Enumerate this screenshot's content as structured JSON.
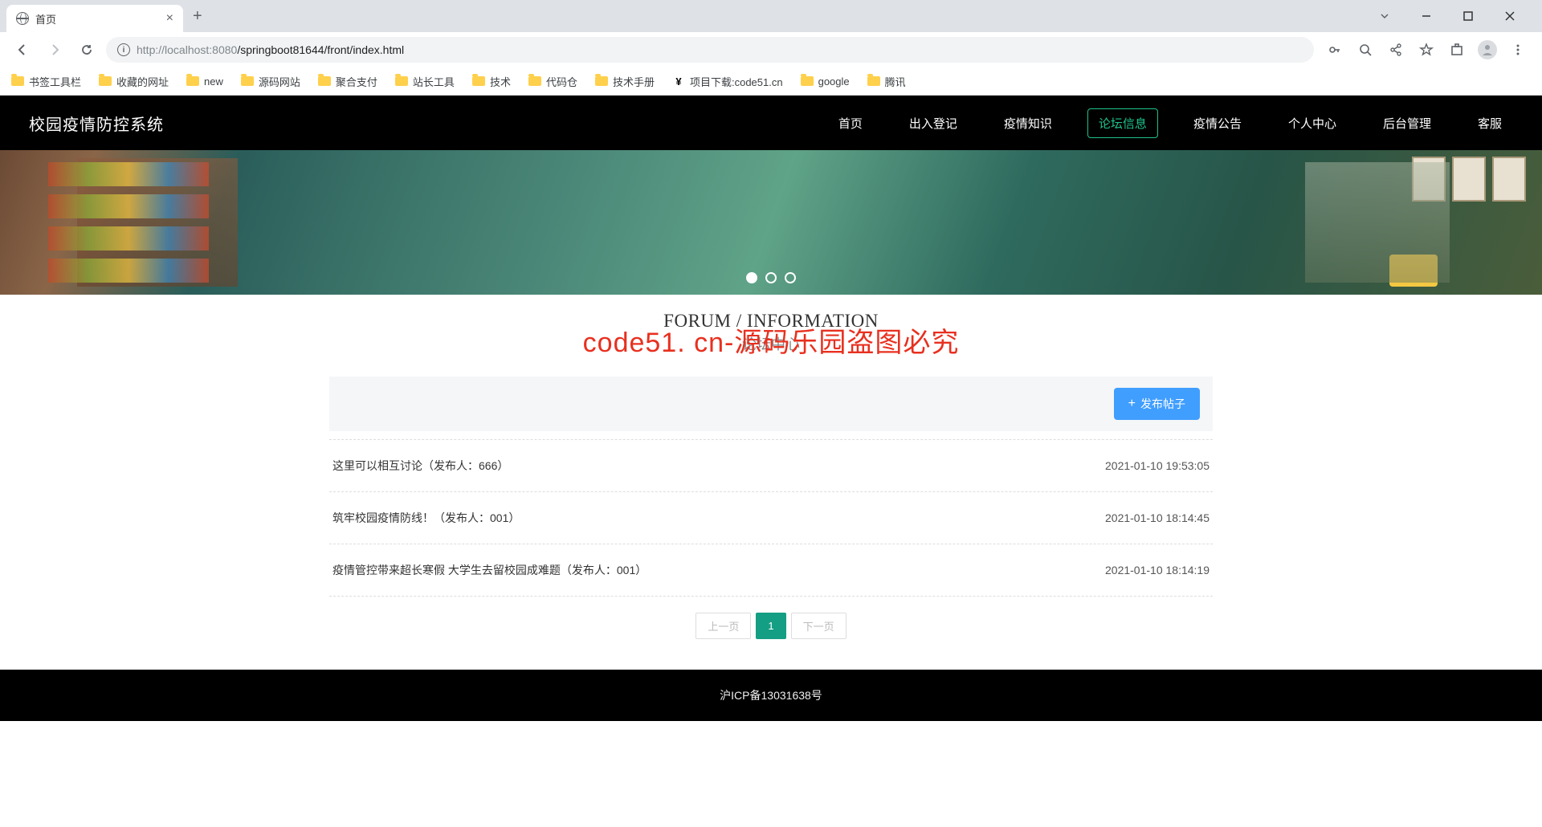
{
  "browser": {
    "tab_title": "首页",
    "url_host": "http://localhost",
    "url_port": ":8080",
    "url_path": "/springboot81644/front/index.html"
  },
  "bookmarks": [
    {
      "label": "书签工具栏",
      "type": "folder"
    },
    {
      "label": "收藏的网址",
      "type": "folder"
    },
    {
      "label": "new",
      "type": "folder"
    },
    {
      "label": "源码网站",
      "type": "folder"
    },
    {
      "label": "聚合支付",
      "type": "folder"
    },
    {
      "label": "站长工具",
      "type": "folder"
    },
    {
      "label": "技术",
      "type": "folder"
    },
    {
      "label": "代码仓",
      "type": "folder"
    },
    {
      "label": "技术手册",
      "type": "folder"
    },
    {
      "label": "项目下载:code51.cn",
      "type": "icon"
    },
    {
      "label": "google",
      "type": "folder"
    },
    {
      "label": "腾讯",
      "type": "folder"
    }
  ],
  "site": {
    "brand": "校园疫情防控系统",
    "nav": [
      {
        "label": "首页",
        "active": false
      },
      {
        "label": "出入登记",
        "active": false
      },
      {
        "label": "疫情知识",
        "active": false
      },
      {
        "label": "论坛信息",
        "active": true
      },
      {
        "label": "疫情公告",
        "active": false
      },
      {
        "label": "个人中心",
        "active": false
      },
      {
        "label": "后台管理",
        "active": false
      },
      {
        "label": "客服",
        "active": false
      }
    ]
  },
  "section": {
    "title_en": "FORUM / INFORMATION",
    "title_zh": "论坛中心",
    "watermark": "code51. cn-源码乐园盗图必究"
  },
  "action": {
    "publish_label": "发布帖子"
  },
  "posts": [
    {
      "title": "这里可以相互讨论（发布人：666）",
      "time": "2021-01-10 19:53:05"
    },
    {
      "title": "筑牢校园疫情防线！（发布人：001）",
      "time": "2021-01-10 18:14:45"
    },
    {
      "title": "疫情管控带来超长寒假 大学生去留校园成难题（发布人：001）",
      "time": "2021-01-10 18:14:19"
    }
  ],
  "pagination": {
    "prev": "上一页",
    "pages": [
      "1"
    ],
    "next": "下一页"
  },
  "footer": {
    "icp": "沪ICP备13031638号"
  }
}
